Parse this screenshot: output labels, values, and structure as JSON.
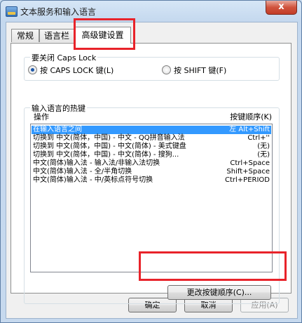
{
  "window": {
    "title": "文本服务和输入语言",
    "close_symbol": "x"
  },
  "tabs": [
    {
      "label": "常规",
      "active": false
    },
    {
      "label": "语言栏",
      "active": false
    },
    {
      "label": "高级键设置",
      "active": true
    }
  ],
  "caps_lock": {
    "legend": "要关闭 Caps Lock",
    "options": [
      {
        "label": "按 CAPS LOCK 键(L)",
        "checked": true
      },
      {
        "label": "按 SHIFT 键(F)",
        "checked": false
      }
    ]
  },
  "hotkeys": {
    "legend": "输入语言的热键",
    "col_operation": "操作",
    "col_key_sequence": "按键顺序(K)",
    "rows": [
      {
        "operation": "在输入语言之间",
        "keys": "左 Alt+Shift",
        "selected": true
      },
      {
        "operation": "切换到 中文(简体，中国) - 中文 - QQ拼音输入法",
        "keys": "Ctrl+''",
        "selected": false
      },
      {
        "operation": "切换到 中文(简体，中国) - 中文(简体) - 美式键盘",
        "keys": "(无)",
        "selected": false
      },
      {
        "operation": "切换到 中文(简体，中国) - 中文(简体) - 搜狗...",
        "keys": "(无)",
        "selected": false
      },
      {
        "operation": "中文(简体)输入法 - 输入法/非输入法切换",
        "keys": "Ctrl+Space",
        "selected": false
      },
      {
        "operation": "中文(简体)输入法 - 全/半角切换",
        "keys": "Shift+Space",
        "selected": false
      },
      {
        "operation": "中文(简体)输入法 - 中/英标点符号切换",
        "keys": "Ctrl+PERIOD",
        "selected": false
      }
    ],
    "change_button": "更改按键顺序(C)..."
  },
  "footer": {
    "ok": "确定",
    "cancel": "取消",
    "apply": "应用(A)"
  }
}
